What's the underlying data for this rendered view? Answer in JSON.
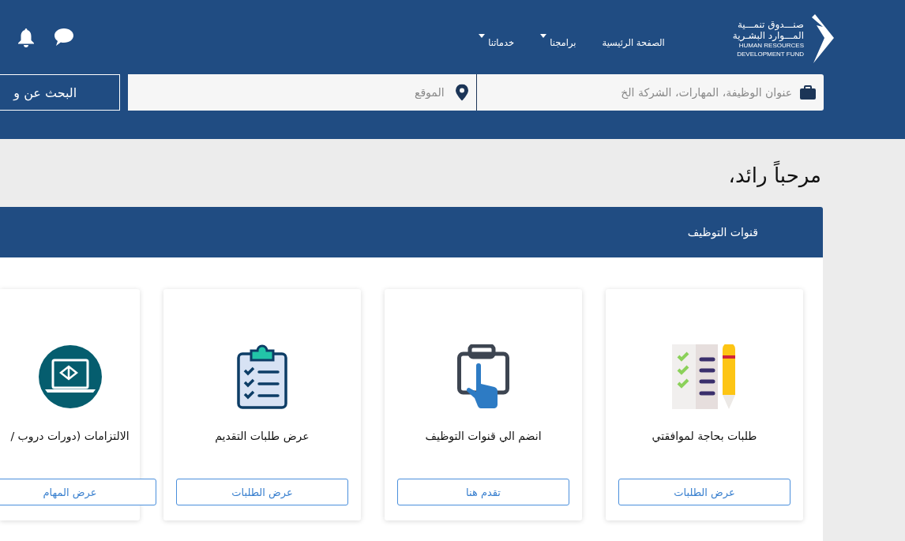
{
  "logo": {
    "arabic_line_1": "صنـــدوق تنمـــية",
    "arabic_line_2": "المـــوارد البشـرية",
    "english_line_1": "HUMAN RESOURCES",
    "english_line_2": "DEVELOPMENT FUND"
  },
  "nav": [
    {
      "label": "الصفحة الرئيسية",
      "kind": "link"
    },
    {
      "label": "برامجنا",
      "kind": "dropdown"
    },
    {
      "label": "خدماتنا",
      "kind": "dropdown"
    }
  ],
  "search": {
    "job_placeholder": "عنوان الوظيفة، المهارات، الشركة الخ",
    "location_placeholder": "الموقع",
    "button": "البحث عن و"
  },
  "greeting": "مرحباً رائد،",
  "panel": {
    "title": "قنوات التوظيف",
    "cards": [
      {
        "kind": "checklist-pencil",
        "title": "طلبات بحاجة لموافقتي",
        "button": "عرض الطلبات"
      },
      {
        "kind": "touch",
        "title": "انضم الي قنوات التوظيف",
        "button": "تقدم هنا"
      },
      {
        "kind": "clipboard",
        "title": "عرض طلبات التقديم",
        "button": "عرض الطلبات"
      },
      {
        "kind": "laptop",
        "title": "الالتزامات (دورات دروب /",
        "button": "عرض المهام"
      }
    ]
  }
}
